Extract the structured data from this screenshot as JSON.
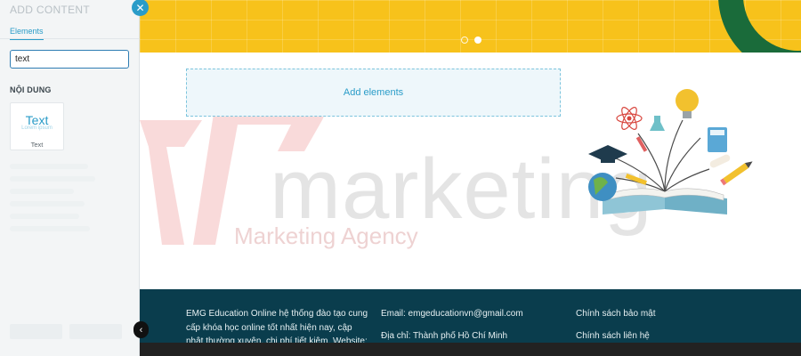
{
  "panel": {
    "title": "ADD CONTENT",
    "tab": "Elements",
    "search_value": "text",
    "section_title": "NỘI DUNG",
    "card": {
      "preview_title": "Text",
      "preview_subtitle": "Lorem ipsum",
      "label": "Text"
    },
    "close_icon": "close-icon",
    "collapse_icon": "chevron-left-icon"
  },
  "canvas": {
    "add_elements": "Add elements",
    "slider": {
      "count": 2,
      "active_index": 1
    },
    "watermark": {
      "word": "marketing",
      "tagline": "Marketing Agency"
    },
    "footer": {
      "col1": "EMG Education Online hệ thống đào tạo cung cấp khóa học online tốt nhất hiện nay, cập nhật thường xuyên, chi phí tiết kiệm. Website:",
      "col2_email": "Email: emgeducationvn@gmail.com",
      "col2_address": "Địa chỉ: Thành phố Hồ Chí Minh",
      "col3_link1": "Chính sách bảo mật",
      "col3_link2": "Chính sách liên hệ"
    }
  },
  "colors": {
    "accent": "#2a9cc8",
    "banner": "#f7c21b",
    "footer": "#0a3d4d"
  }
}
